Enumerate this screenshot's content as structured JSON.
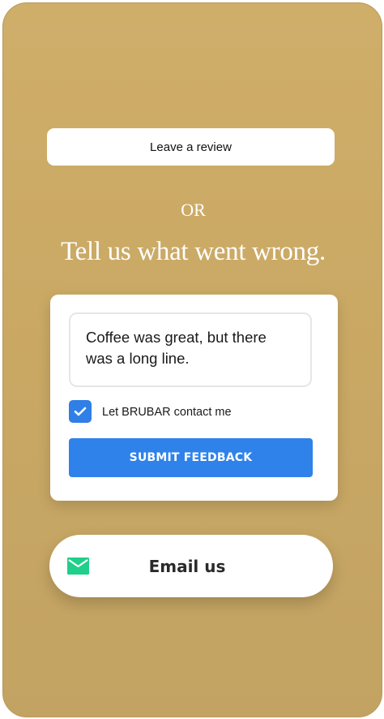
{
  "review": {
    "label": "Leave a review"
  },
  "divider": {
    "text": "OR"
  },
  "headline": {
    "text": "Tell us what went wrong."
  },
  "feedback": {
    "value": "Coffee was great, but there was a long line.",
    "contact_label": "Let BRUBAR contact me",
    "contact_checked": true,
    "submit_label": "SUBMIT FEEDBACK"
  },
  "email": {
    "label": "Email us",
    "icon": "envelope-icon"
  },
  "colors": {
    "background": "#c9a864",
    "accent_blue": "#2f82ea",
    "email_icon": "#1fcf8a"
  }
}
